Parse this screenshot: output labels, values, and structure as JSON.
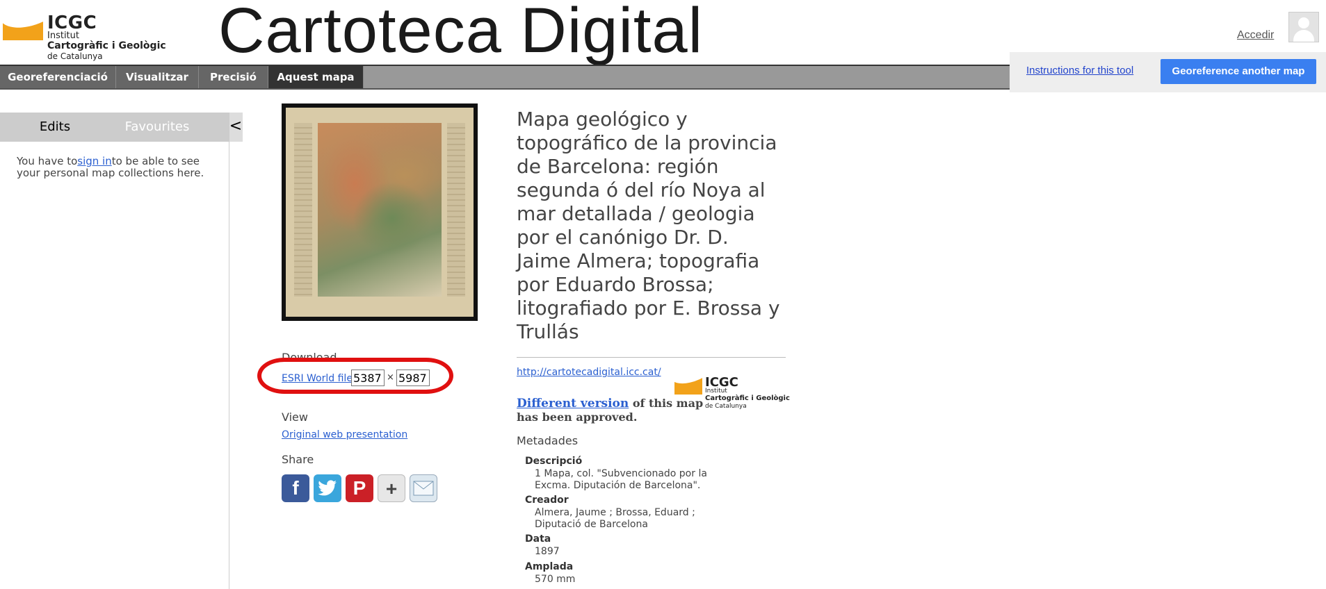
{
  "header": {
    "logo": {
      "acronym": "ICGC",
      "line1": "Institut",
      "line2": "Cartogràfic i Geològic",
      "line3": "de Catalunya"
    },
    "site_title": "Cartoteca Digital",
    "login_label": "Accedir"
  },
  "nav": {
    "tabs": [
      {
        "label": "Georeferenciació",
        "active": false
      },
      {
        "label": "Visualitzar",
        "active": false
      },
      {
        "label": "Precisió",
        "active": false
      },
      {
        "label": "Aquest mapa",
        "active": true
      }
    ]
  },
  "toolbox": {
    "instructions_label": "Instructions for this tool",
    "georeference_button": "Georeference another map"
  },
  "sidebar": {
    "tabs": [
      {
        "label": "Edits"
      },
      {
        "label": "Favourites"
      }
    ],
    "collapse_label": "<",
    "message_before": "You have to",
    "sign_in_link": "sign in",
    "message_after": "to be able to see your personal map collections here."
  },
  "download": {
    "heading": "Download",
    "esri_link": "ESRI World file",
    "width": "5387",
    "times": "×",
    "height": "5987"
  },
  "view": {
    "heading": "View",
    "link": "Original web presentation"
  },
  "share": {
    "heading": "Share",
    "icons": [
      "facebook-icon",
      "twitter-icon",
      "pinterest-icon",
      "google-plus-icon",
      "email-icon"
    ]
  },
  "map": {
    "title": "Mapa geológico y topográfico de la provincia de Barcelona: región segunda ó del río Noya al mar detallada / geologia por el canónigo Dr. D. Jaime Almera; topografia por Eduardo Brossa; litografiado por E. Brossa y Trullás",
    "source_link": "http://cartotecadigital.icc.cat/",
    "different_version_link": "Different version",
    "different_version_text": " of this map has been approved.",
    "metadata_heading": "Metadades",
    "metadata": [
      {
        "key": "Descripció",
        "value": "1 Mapa, col. \"Subvencionado por la Excma. Diputación de Barcelona\"."
      },
      {
        "key": "Creador",
        "value": "Almera, Jaume ; Brossa, Eduard ; Diputació de Barcelona"
      },
      {
        "key": "Data",
        "value": "1897"
      },
      {
        "key": "Amplada",
        "value": "570 mm"
      }
    ]
  },
  "colors": {
    "accent_blue": "#3a7ff0",
    "logo_orange": "#f2a21a",
    "nav_active": "#333333",
    "highlight_red": "#e01010"
  }
}
